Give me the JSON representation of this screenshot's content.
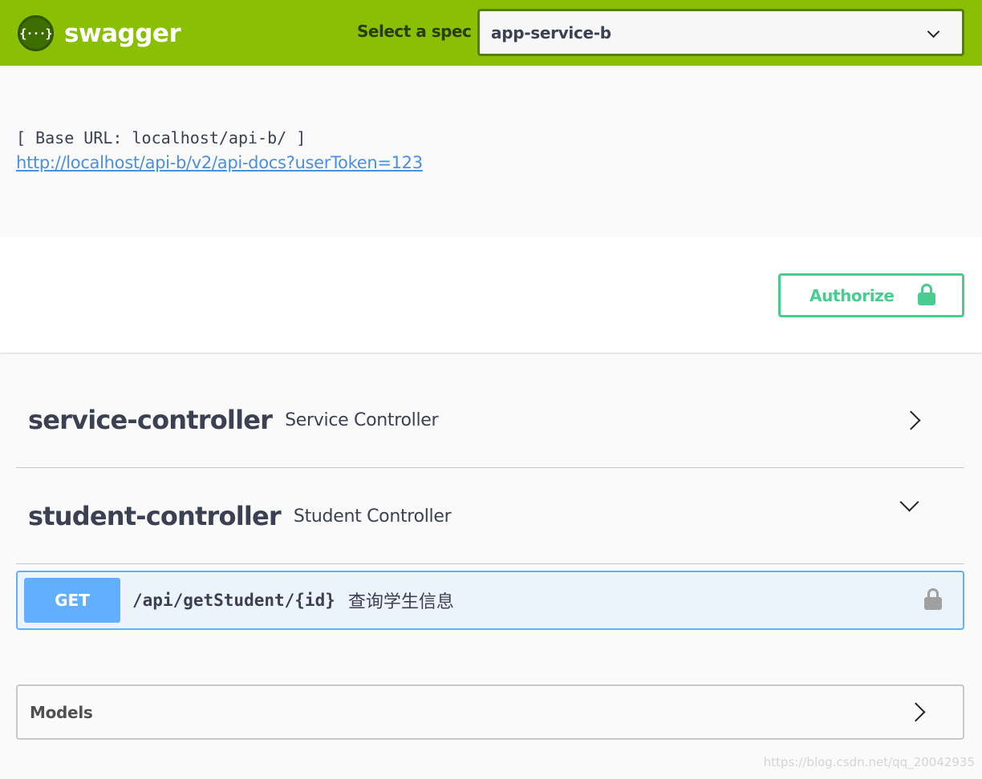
{
  "topbar": {
    "brand": "swagger",
    "logo_glyph": "{···}",
    "spec_label": "Select a spec",
    "spec_value": "app-service-b"
  },
  "info": {
    "base_url": "[ Base URL: localhost/api-b/ ]",
    "docs_link": "http://localhost/api-b/v2/api-docs?userToken=123"
  },
  "auth": {
    "authorize_label": "Authorize",
    "accent_color": "#49cc90"
  },
  "tags": [
    {
      "name": "service-controller",
      "description": "Service Controller",
      "expanded": false
    },
    {
      "name": "student-controller",
      "description": "Student Controller",
      "expanded": true
    }
  ],
  "operations": [
    {
      "method": "GET",
      "path": "/api/getStudent/{id}",
      "summary": "查询学生信息",
      "method_color": "#61affe"
    }
  ],
  "models": {
    "label": "Models"
  },
  "watermark": "https://blog.csdn.net/qq_20042935",
  "colors": {
    "topbar": "#89bf04",
    "get": "#61affe",
    "authorize": "#49cc90"
  }
}
